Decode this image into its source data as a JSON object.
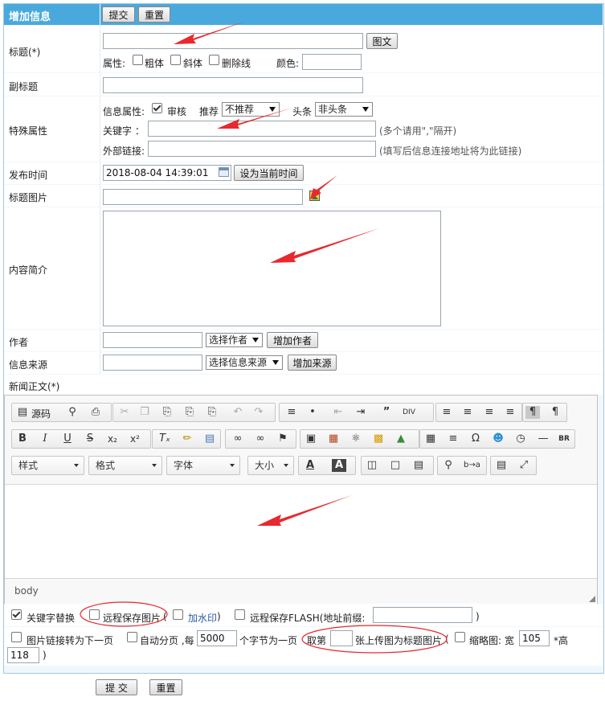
{
  "header": {
    "title": "增加信息",
    "submit": "提交",
    "reset": "重置"
  },
  "title_row": {
    "label": "标题(*)",
    "value": "",
    "tuwen_button": "图文",
    "attr_label": "属性:",
    "bold": "粗体",
    "italic": "斜体",
    "strike": "删除线",
    "color_label": "颜色:",
    "color_value": ""
  },
  "subtitle_row": {
    "label": "副标题",
    "value": ""
  },
  "special_row": {
    "label": "特殊属性",
    "info_attr_label": "信息属性:",
    "audit": "审核",
    "recommend_label": "推荐",
    "recommend_value": "不推荐",
    "headline_label": "头条",
    "headline_value": "非头条",
    "keyword_label": "关键字 ：",
    "keyword_hint": "(多个请用\",\"隔开)",
    "external_label": "外部链接:",
    "external_hint": "(填写后信息连接地址将为此链接)"
  },
  "publish_row": {
    "label": "发布时间",
    "value": "2018-08-04 14:39:01",
    "set_now": "设为当前时间"
  },
  "image_row": {
    "label": "标题图片",
    "value": ""
  },
  "summary_row": {
    "label": "内容简介",
    "value": ""
  },
  "author_row": {
    "label": "作者",
    "value": "",
    "select": "选择作者",
    "add": "增加作者"
  },
  "source_row": {
    "label": "信息来源",
    "value": "",
    "select": "选择信息来源",
    "add": "增加来源"
  },
  "body_label": "新闻正文(*)",
  "editor": {
    "source_label": "源码",
    "style_combo": "样式",
    "format_combo": "格式",
    "font_combo": "字体",
    "size_combo": "大小",
    "status_path": "body"
  },
  "options1": {
    "keyword_replace": "关键字替换",
    "remote_save_image": "远程保存图片",
    "watermark": "加水印",
    "remote_save_flash": "远程保存FLASH(地址前缀:",
    "flash_prefix_value": "",
    "close_paren": ")",
    "open_paren": "(",
    "close_paren2": ")"
  },
  "options2": {
    "image_link_next": "图片链接转为下一页",
    "auto_page": "自动分页 ,每",
    "page_size": "5000",
    "page_size_unit": "个字节为一页",
    "take_nth": "取第",
    "nth_value": "",
    "upload_as_title": "张上传图为标题图片",
    "open_paren": "(",
    "thumb_label": "缩略图: 宽",
    "thumb_width": "105",
    "height_label": "*高",
    "thumb_height": "118",
    "close_paren": ")"
  },
  "footer": {
    "submit": "提 交",
    "reset": "重置"
  },
  "colors": {
    "header_bg": "#4aa9dc",
    "arrow": "#e8282d",
    "frame": "#9cc8e6"
  }
}
